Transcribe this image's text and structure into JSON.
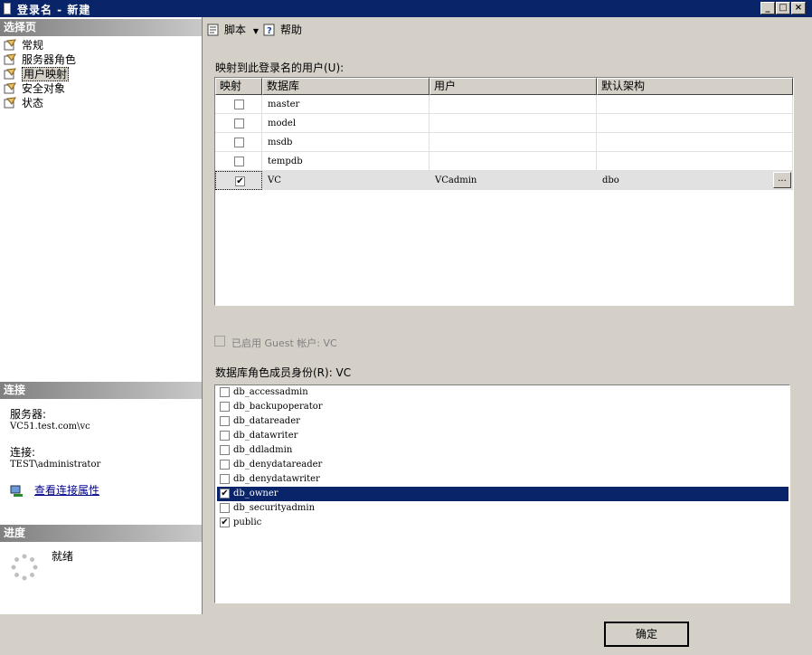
{
  "window": {
    "title": "登录名 - 新建",
    "buttons": [
      "_",
      "□",
      "×"
    ]
  },
  "left": {
    "select_page_header": "选择页",
    "nav_items": [
      {
        "label": "常规",
        "selected": false
      },
      {
        "label": "服务器角色",
        "selected": false
      },
      {
        "label": "用户映射",
        "selected": true
      },
      {
        "label": "安全对象",
        "selected": false
      },
      {
        "label": "状态",
        "selected": false
      }
    ],
    "connection_header": "连接",
    "server_label": "服务器:",
    "server_value": "VC51.test.com\\vc",
    "connection_label": "连接:",
    "connection_value": "TEST\\administrator",
    "view_conn_props": "查看连接属性",
    "progress_header": "进度",
    "progress_status": "就绪"
  },
  "toolbar": {
    "script_label": "脚本",
    "help_label": "帮助"
  },
  "mapping": {
    "label": "映射到此登录名的用户(U):",
    "columns": [
      "映射",
      "数据库",
      "用户",
      "默认架构"
    ],
    "rows": [
      {
        "mapped": false,
        "database": "master",
        "user": "",
        "schema": ""
      },
      {
        "mapped": false,
        "database": "model",
        "user": "",
        "schema": ""
      },
      {
        "mapped": false,
        "database": "msdb",
        "user": "",
        "schema": ""
      },
      {
        "mapped": false,
        "database": "tempdb",
        "user": "",
        "schema": ""
      },
      {
        "mapped": true,
        "database": "VC",
        "user": "VCadmin",
        "schema": "dbo"
      }
    ],
    "ellipsis": "..."
  },
  "guest": {
    "label": "已启用 Guest 帐户: VC",
    "checked": false
  },
  "roles": {
    "label": "数据库角色成员身份(R): VC",
    "items": [
      {
        "name": "db_accessadmin",
        "checked": false,
        "selected": false
      },
      {
        "name": "db_backupoperator",
        "checked": false,
        "selected": false
      },
      {
        "name": "db_datareader",
        "checked": false,
        "selected": false
      },
      {
        "name": "db_datawriter",
        "checked": false,
        "selected": false
      },
      {
        "name": "db_ddladmin",
        "checked": false,
        "selected": false
      },
      {
        "name": "db_denydatareader",
        "checked": false,
        "selected": false
      },
      {
        "name": "db_denydatawriter",
        "checked": false,
        "selected": false
      },
      {
        "name": "db_owner",
        "checked": true,
        "selected": true
      },
      {
        "name": "db_securityadmin",
        "checked": false,
        "selected": false
      },
      {
        "name": "public",
        "checked": true,
        "selected": false
      }
    ]
  },
  "footer": {
    "ok_label": "确定"
  }
}
